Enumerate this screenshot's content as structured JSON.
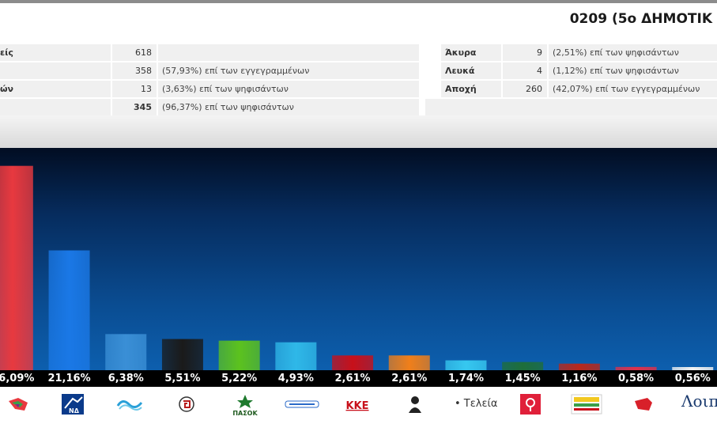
{
  "header": {
    "title": "0209 (5ο ΔΗΜΟΤΙΚ"
  },
  "stats": {
    "left": [
      {
        "label": "είς",
        "value": "618",
        "desc": ""
      },
      {
        "label": "",
        "value": "358",
        "desc": "(57,93%) επί των εγγεγραμμένων"
      },
      {
        "label": "ών",
        "value": "13",
        "desc": "(3,63%) επί των ψηφισάντων"
      },
      {
        "label": "",
        "value": "345",
        "desc": "(96,37%) επί των ψηφισάντων"
      }
    ],
    "right": [
      {
        "label": "Άκυρα",
        "value": "9",
        "desc": "(2,51%) επί των ψηφισάντων"
      },
      {
        "label": "Λευκά",
        "value": "4",
        "desc": "(1,12%) επί των ψηφισάντων"
      },
      {
        "label": "Αποχή",
        "value": "260",
        "desc": "(42,07%) επί των εγγεγραμμένων"
      }
    ]
  },
  "chart_data": {
    "type": "bar",
    "values": [
      36.09,
      21.16,
      6.38,
      5.51,
      5.22,
      4.93,
      2.61,
      2.61,
      1.74,
      1.45,
      1.16,
      0.58,
      0.56
    ],
    "labels": [
      "6,09%",
      "21,16%",
      "6,38%",
      "5,51%",
      "5,22%",
      "4,93%",
      "2,61%",
      "2,61%",
      "1,74%",
      "1,45%",
      "1,16%",
      "0,58%",
      "0,56%"
    ],
    "colors": [
      "#e8393f",
      "#1a78e6",
      "#3a8fd6",
      "#1a1a1a",
      "#5cc21e",
      "#2fb8e8",
      "#c8101a",
      "#f07f1a",
      "#36c8f0",
      "#1e6e3a",
      "#b8281c",
      "#e0304a",
      "#f2f2f2"
    ],
    "logos": [
      "syriza-icon",
      "nd-icon",
      "potami-icon",
      "golden-dawn-icon",
      "pasok-icon",
      "anel-icon",
      "kke-icon",
      "centrists-icon",
      "teleia-icon",
      "antarsya-icon",
      "prasinoi-icon",
      "laiki-enotita-icon",
      "loipoi-icon"
    ],
    "logo_texts": {
      "pasok": "ΠΑΣΟΚ",
      "kke": "ΚΚΕ",
      "teleia": "• Τελεία",
      "loipoi": "Λοιποί"
    },
    "ymax": 38
  }
}
